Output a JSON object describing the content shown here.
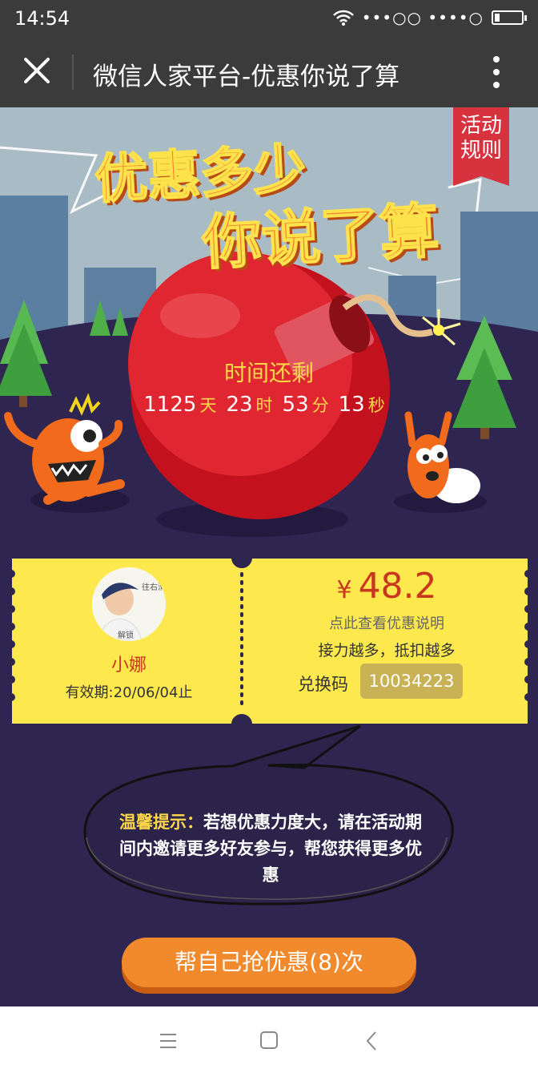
{
  "status_bar": {
    "time": "14:54",
    "signal_text": "•••○○ ••••○"
  },
  "title_bar": {
    "title": "微信人家平台-优惠你说了算"
  },
  "hero": {
    "rules_button": "活动规则",
    "headline_line1": "优惠多少",
    "headline_line2": "你说了算",
    "countdown_label": "时间还剩",
    "countdown": {
      "days": "1125",
      "days_unit": "天",
      "hours": "23",
      "hours_unit": "时",
      "minutes": "53",
      "minutes_unit": "分",
      "seconds": "13",
      "seconds_unit": "秒"
    }
  },
  "coupon": {
    "avatar_caption": "往右滑 解锁",
    "username": "小娜",
    "validity": "有效期:20/06/04止",
    "currency": "¥",
    "amount": "48.2",
    "details_link": "点此查看优惠说明",
    "relay_text": "接力越多，抵扣越多",
    "code_label": "兑换码",
    "code": "10034223"
  },
  "tip": {
    "label": "温馨提示：",
    "text": "若想优惠力度大，请在活动期间内邀请更多好友参与，帮您获得更多优惠"
  },
  "cta": {
    "label": "帮自己抢优惠(8)次"
  },
  "colors": {
    "bg_purple": "#2e2550",
    "ticket_yellow": "#fde84d",
    "accent_red": "#c8361f",
    "cta_orange": "#f08a2c"
  }
}
